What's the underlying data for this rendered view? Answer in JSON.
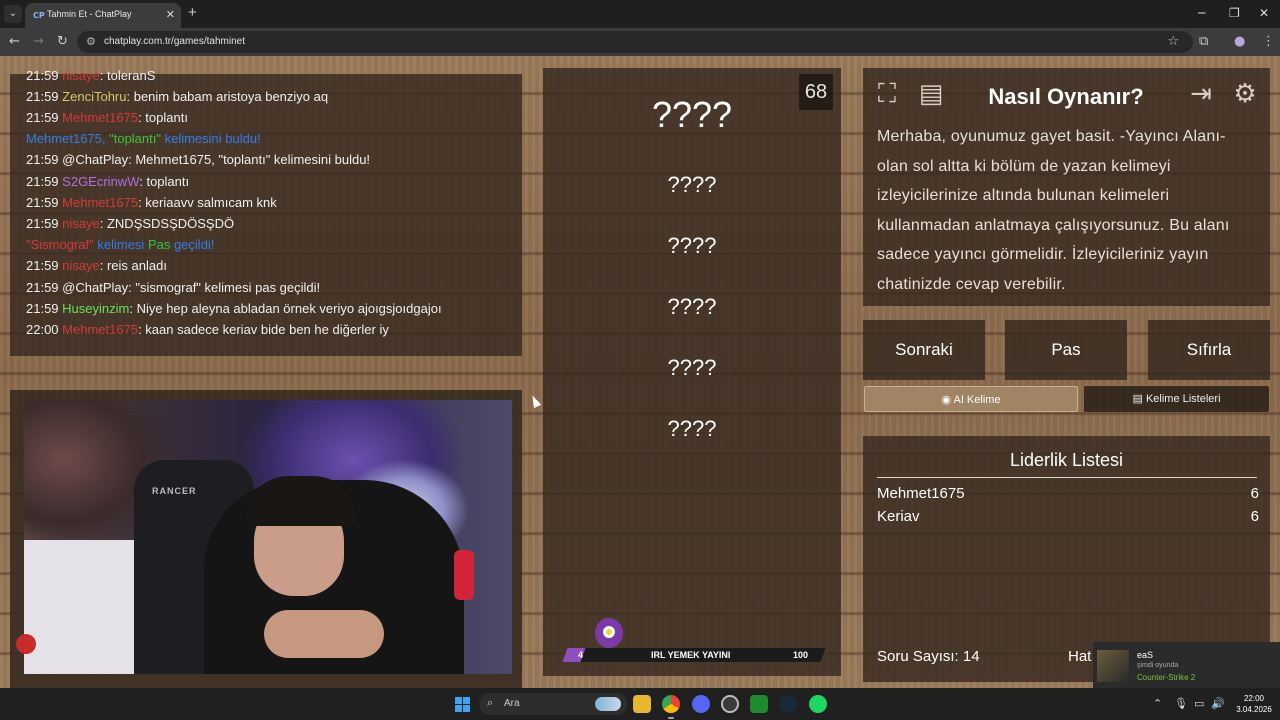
{
  "browser": {
    "tab_title": "Tahmin Et - ChatPlay",
    "tab_favicon_text": "CP",
    "url": "chatplay.com.tr/games/tahminet"
  },
  "chat": {
    "lines": [
      {
        "time": "21:59",
        "user": "nisaye",
        "user_color": "#d23a3a",
        "msg": ": toleranS"
      },
      {
        "time": "21:59",
        "user": "ZenciTohru",
        "user_color": "#d8c46a",
        "msg": ": benim babam aristoya benziyo aq"
      },
      {
        "time": "21:59",
        "user": "Mehmet1675",
        "user_color": "#d23a3a",
        "msg": ": toplantı"
      },
      {
        "time": "21:59",
        "user": "@ChatPlay",
        "user_color": "#f0f0f0",
        "msg": ": Mehmet1675, \"toplantı\" kelimesini buldu!"
      },
      {
        "time": "21:59",
        "user": "S2GEcrinwW",
        "user_color": "#b070e0",
        "msg": ": toplantı"
      },
      {
        "time": "21:59",
        "user": "Mehmet1675",
        "user_color": "#d23a3a",
        "msg": ": keriaavv salmıcam knk"
      },
      {
        "time": "21:59",
        "user": "nisaye",
        "user_color": "#d23a3a",
        "msg": ": ZNDŞSDSŞDÖSŞDÖ"
      },
      {
        "time": "21:59",
        "user": "nisaye",
        "user_color": "#d23a3a",
        "msg": ": reis anladı"
      },
      {
        "time": "21:59",
        "user": "@ChatPlay",
        "user_color": "#f0f0f0",
        "msg": ": \"sismograf\" kelimesi pas geçildi!"
      },
      {
        "time": "21:59",
        "user": "Huseyinzim",
        "user_color": "#66e056",
        "msg": ": Niye hep aleyna abladan örnek veriyo ajoıgsjoıdgajoı"
      },
      {
        "time": "22:00",
        "user": "Mehmet1675",
        "user_color": "#d23a3a",
        "msg": ": kaan sadece keriav bide ben he diğerler iy"
      }
    ],
    "found_notice": {
      "user": "Mehmet1675, ",
      "word": "\"toplantı\"",
      "suffix": " kelimesini buldu!"
    },
    "pass_notice": {
      "word": "\"Sismograf\"",
      "mid": " kelimesi ",
      "pas": "Pas",
      "suffix": " geçildi!"
    }
  },
  "video": {
    "chair_brand": "RANCER"
  },
  "words": {
    "counter": "68",
    "main": "????",
    "hidden": [
      "????",
      "????",
      "????",
      "????",
      "????"
    ],
    "stream_level": "4",
    "stream_title": "IRL YEMEK YAYINI",
    "stream_value": "100"
  },
  "howto": {
    "title": "Nasıl Oynanır?",
    "text": "Merhaba, oyunumuz gayet basit. -Yayıncı Alanı- olan sol altta ki bölüm de yazan kelimeyi izleyicilerinize altında bulunan kelimeleri kullanmadan anlatmaya çalışıyorsunuz. Bu alanı sadece yayıncı görmelidir. İzleyicileriniz yayın chatinizde cevap verebilir.",
    "icons": [
      "expand-icon",
      "rules-book-icon",
      "exit-icon",
      "settings-gear-icon"
    ]
  },
  "controls": {
    "next": "Sonraki",
    "pass": "Pas",
    "reset": "Sıfırla",
    "ai_tab": "AI Kelime",
    "lists_tab": "Kelime Listeleri"
  },
  "leaderboard": {
    "title": "Liderlik Listesi",
    "rows": [
      {
        "name": "Mehmet1675",
        "score": "6"
      },
      {
        "name": "Keriav",
        "score": "6"
      }
    ],
    "questions": "Soru Sayısı: 14",
    "hat_label": "Hat"
  },
  "toast": {
    "name": "eaS",
    "status": "şimdi oyunda",
    "game": "Counter-Strike 2"
  },
  "taskbar": {
    "search_placeholder": "Ara",
    "time": "22:00",
    "date": "3.04.2026"
  }
}
